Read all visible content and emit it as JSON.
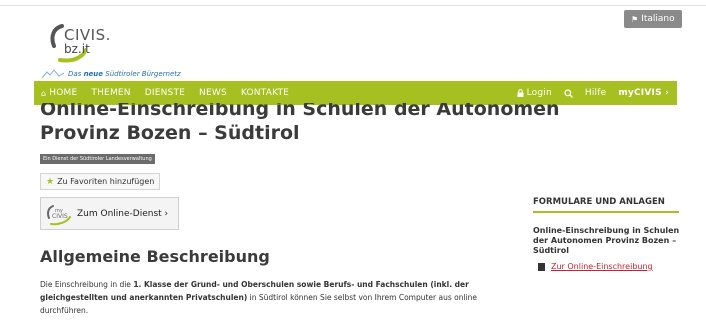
{
  "header": {
    "logo_civis": "CIVIS.",
    "logo_domain": "bz.it",
    "tagline_prefix": "Das",
    "tagline_bold": "neue",
    "tagline_suffix": "Südtiroler Bürgernetz",
    "language_button": "Italiano"
  },
  "nav": {
    "left": [
      "HOME",
      "THEMEN",
      "DIENSTE",
      "NEWS",
      "KONTAKTE"
    ],
    "login": "Login",
    "help": "Hilfe",
    "mycivis": "myCIVIS ›"
  },
  "main": {
    "title_line1": "Online-Einschreibung in Schulen der Autonomen",
    "title_line2": "Provinz Bozen – Südtirol",
    "badge": "Ein Dienst der Südtiroler Landesverwaltung",
    "favorites_button": "Zu Favoriten hinzufügen",
    "service_button": "Zum Online-Dienst ›",
    "service_logo_my": "my",
    "service_logo_civis": "CIVIS",
    "section_heading": "Allgemeine Beschreibung",
    "body_1": "Die Einschreibung in die ",
    "body_bold": "1. Klasse der Grund- und Oberschulen sowie Berufs- und Fachschulen (inkl. der gleichgestellten und anerkannten Privatschulen)",
    "body_2": " in Südtirol können Sie selbst von Ihrem Computer aus online durchführen."
  },
  "sidebar": {
    "heading": "FORMULARE UND ANLAGEN",
    "title": "Online-Einschreibung in Schulen der Autonomen Provinz Bozen – Südtirol",
    "link": "Zur Online-Einschreibung"
  },
  "colors": {
    "accent_green": "#a6c021",
    "link_red": "#c0262d"
  }
}
